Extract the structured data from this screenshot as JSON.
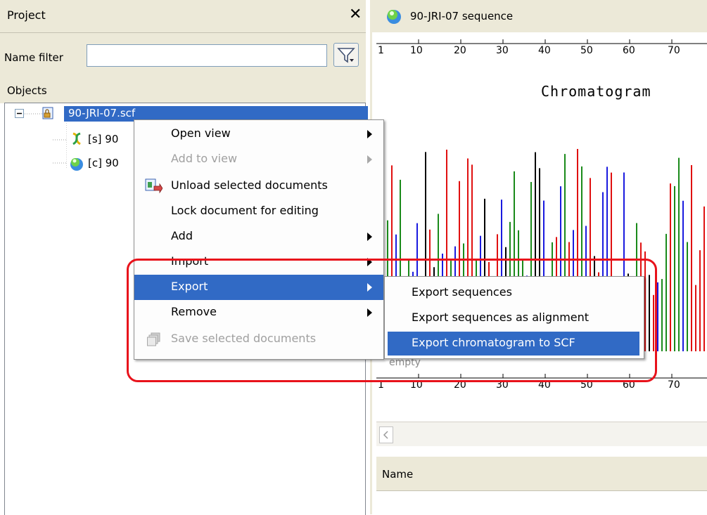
{
  "project_panel": {
    "title": "Project",
    "close_glyph": "✕",
    "name_filter_label": "Name filter",
    "name_filter_value": "",
    "objects_label": "Objects",
    "tree": [
      {
        "label": "90-JRI-07.scf",
        "icon": "document-icon",
        "selected": true
      },
      {
        "label": "[s] 90",
        "icon": "sequence-icon"
      },
      {
        "label": "[c] 90",
        "icon": "chromatogram-icon"
      }
    ]
  },
  "editor": {
    "title": "90-JRI-07 sequence",
    "ruler_ticks": [
      "1",
      "10",
      "20",
      "30",
      "40",
      "50",
      "60",
      "70"
    ],
    "chromatogram_title": "Chromatogram",
    "empty_label": "empty",
    "name_column": "Name"
  },
  "context_menu": {
    "items": [
      {
        "label": "Open view",
        "submenu": true,
        "disabled": false
      },
      {
        "label": "Add to view",
        "submenu": true,
        "disabled": true
      },
      {
        "label": "Unload selected documents",
        "submenu": false,
        "disabled": false,
        "icon": "unload-icon"
      },
      {
        "label": "Lock document for editing",
        "submenu": false,
        "disabled": false
      },
      {
        "label": "Add",
        "submenu": true,
        "disabled": false
      },
      {
        "label": "Import",
        "submenu": true,
        "disabled": false
      },
      {
        "label": "Export",
        "submenu": true,
        "disabled": false,
        "selected": true
      },
      {
        "label": "Remove",
        "submenu": true,
        "disabled": false
      },
      {
        "label": "Save selected documents",
        "submenu": false,
        "disabled": true,
        "icon": "save-icon"
      }
    ]
  },
  "export_submenu": {
    "items": [
      {
        "label": "Export sequences"
      },
      {
        "label": "Export sequences as alignment"
      },
      {
        "label": "Export chromatogram to SCF",
        "selected": true
      }
    ]
  },
  "colors": {
    "selection": "#316ac5",
    "highlight": "#e8121b",
    "trace_a": "#1a8a1a",
    "trace_c": "#1a1adf",
    "trace_g": "#000000",
    "trace_t": "#e01010"
  }
}
